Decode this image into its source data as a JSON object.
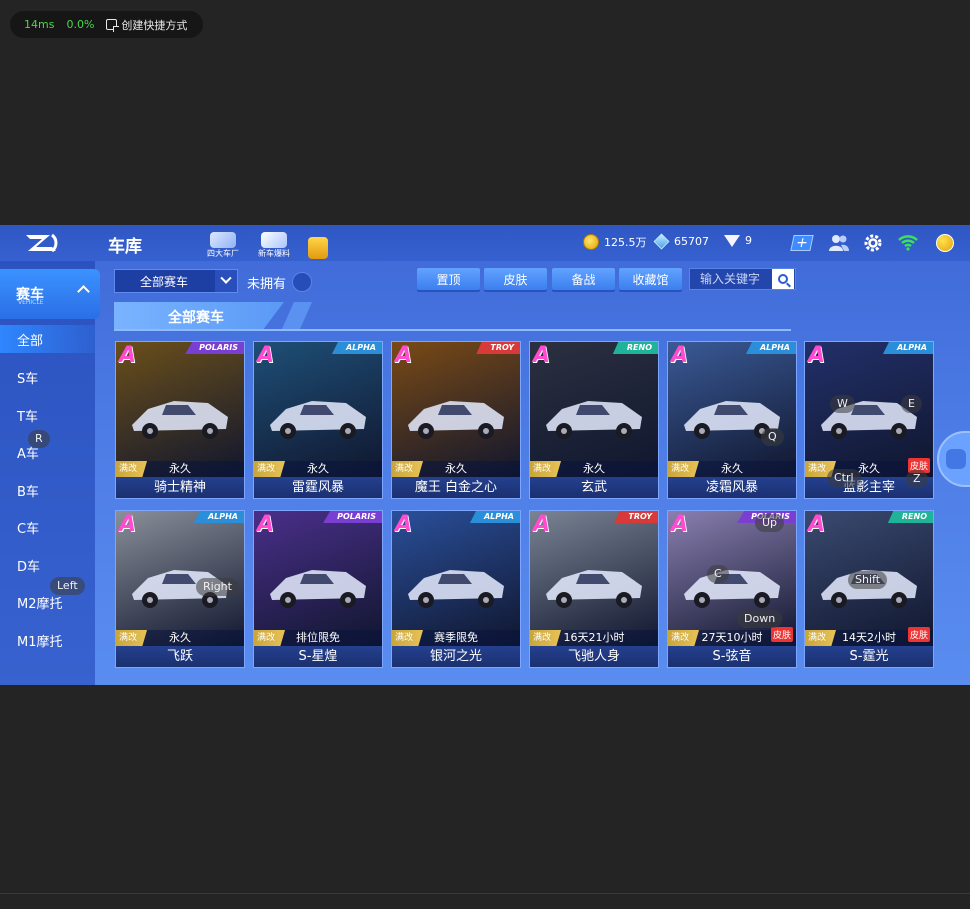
{
  "overlay": {
    "latency": "14ms",
    "loss": "0.0%",
    "shortcut_label": "创建快捷方式"
  },
  "header": {
    "title": "车库",
    "icons": [
      {
        "label": "四大车厂",
        "icon": "factory-icon"
      },
      {
        "label": "新车爆料",
        "icon": "new-car-icon"
      },
      {
        "label": "",
        "icon": "gift-icon"
      }
    ],
    "coins": "125.5万",
    "gems": "65707",
    "diamonds": "9"
  },
  "sidebar": {
    "header": "赛车",
    "header_sub": "VEHICLE",
    "items": [
      "全部",
      "S车",
      "T车",
      "A车",
      "B车",
      "C车",
      "D车",
      "M2摩托",
      "M1摩托"
    ]
  },
  "filter": {
    "selected": "全部赛车",
    "unowned_label": "未拥有"
  },
  "buttons": {
    "pin": "置顶",
    "skin": "皮肤",
    "prepare": "备战",
    "collection": "收藏馆"
  },
  "search": {
    "placeholder": "输入关键字"
  },
  "section_title": "全部赛车",
  "cards": [
    {
      "grade": "A",
      "brand": "POLARIS",
      "brand_color": "#7a3fd0",
      "tag": "满改",
      "duration": "永久",
      "name": "骑士精神",
      "skin": "",
      "art": "#6b4f1a"
    },
    {
      "grade": "A",
      "brand": "ALPHA",
      "brand_color": "#2a8ed8",
      "tag": "满改",
      "duration": "永久",
      "name": "雷霆风暴",
      "skin": "",
      "art": "#1e4f77"
    },
    {
      "grade": "A",
      "brand": "TROY",
      "brand_color": "#d83a3a",
      "tag": "满改",
      "duration": "永久",
      "name": "魔王 白金之心",
      "skin": "",
      "art": "#7a4a15"
    },
    {
      "grade": "A",
      "brand": "RENO",
      "brand_color": "#1fb39a",
      "tag": "满改",
      "duration": "永久",
      "name": "玄武",
      "skin": "",
      "art": "#2b3140"
    },
    {
      "grade": "A",
      "brand": "ALPHA",
      "brand_color": "#2a8ed8",
      "tag": "满改",
      "duration": "永久",
      "name": "凌霜风暴",
      "skin": "",
      "art": "#3a5a96"
    },
    {
      "grade": "A",
      "brand": "ALPHA",
      "brand_color": "#2a8ed8",
      "tag": "满改",
      "duration": "永久",
      "name": "蓝影主宰",
      "skin": "皮肤",
      "art": "#22306a"
    },
    {
      "grade": "A",
      "brand": "ALPHA",
      "brand_color": "#2a8ed8",
      "tag": "满改",
      "duration": "永久",
      "name": "飞跃",
      "skin": "",
      "art": "#8a8f9a"
    },
    {
      "grade": "A",
      "brand": "POLARIS",
      "brand_color": "#7a3fd0",
      "tag": "满改",
      "duration": "排位限免",
      "name": "S-星煌",
      "skin": "",
      "art": "#4a2f8a"
    },
    {
      "grade": "A",
      "brand": "ALPHA",
      "brand_color": "#2a8ed8",
      "tag": "满改",
      "duration": "赛季限免",
      "name": "银河之光",
      "skin": "",
      "art": "#2a4f9a"
    },
    {
      "grade": "A",
      "brand": "TROY",
      "brand_color": "#d83a3a",
      "tag": "满改",
      "duration": "16天21小时",
      "name": "飞驰人身",
      "skin": "",
      "art": "#7a8494"
    },
    {
      "grade": "A",
      "brand": "POLARIS",
      "brand_color": "#7a3fd0",
      "tag": "满改",
      "duration": "27天10小时",
      "name": "S-弦音",
      "skin": "皮肤",
      "art": "#8a7fb0"
    },
    {
      "grade": "A",
      "brand": "RENO",
      "brand_color": "#1fb39a",
      "tag": "满改",
      "duration": "14天2小时",
      "name": "S-霆光",
      "skin": "皮肤",
      "art": "#3a4a70"
    }
  ],
  "key_hints": [
    "R",
    "Left",
    "Right",
    "W",
    "E",
    "Q",
    "Ctrl",
    "Z",
    "Up",
    "C",
    "Down",
    "Shift"
  ]
}
